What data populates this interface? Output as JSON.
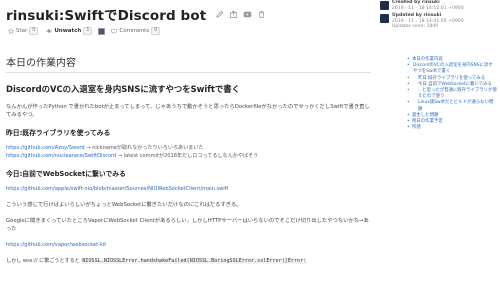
{
  "header": {
    "title": "rinsuki:SwiftでDiscord bot",
    "star_label": "Star",
    "star_count": "0",
    "watch_label": "Unwatch",
    "watch_count": "1",
    "comments_label": "Comments",
    "comments_count": "0",
    "icons": [
      "edit-icon",
      "share-icon",
      "youtube-icon",
      "trash-icon"
    ]
  },
  "info": {
    "created_label": "Created by rinsuki",
    "created_date": "2019 - 11 - 18 14:12:01 +0900",
    "updated_label": "Updated by rinsuki",
    "updated_date": "2019 - 11 - 18 14:41:05 +0900",
    "views": "Updates seen: 1840"
  },
  "main": {
    "section_title": "本日の作業内容",
    "h2": "DiscordのVCの入退室を身内SNSに流すやつをSwiftで書く",
    "intro": "なんかんが作ったPython で書かれたbotが止まってしまって、じゃあうちで動かそうと思ったらDockerfileがなかったのでせっかくだしSwiftで書き直してみるやつ。",
    "lib_heading": "昨日:既存ライブラリを使ってみる",
    "lib_link1": "https://github.com/Azoy/Sword",
    "lib_link1_note": " → nicknameが取れなかったりいろいろあいまいた",
    "lib_link2": "https://github.com/nuclearace/SwiftDiscord",
    "lib_link2_note": " → latest commitが2018年だしロコってるしなんかやばそう",
    "ws_heading": "今日:自前でWebSocketに繋いでみる",
    "ws_link1": "https://github.com/apple/swift-nio/blob/master/Sources/NIOWebSocketClient/main.swift",
    "ws_text1": "こういう感じで行けばよいらしいがちょっとWebSocketに繋ぎたいだけなのにこれはだるすぎる。",
    "ws_text2": "Googleに聞きまくっていたところVaporにWebSocket Clientがあるらしい。しかしHTTPサーバーはいらないのでそこだけ切り出したやつないかな→あった",
    "ws_link2": "https://github.com/vapor/websocket-kit",
    "code_prefix": "しかし wss:// に繋ごうとすると ",
    "code_text": "NIOSSL.NIOSSLError.handshakeFailed(NIOSSL.BoringSSLError.sslError([Error:"
  },
  "toc": {
    "items": [
      {
        "label": "本日の作業内容",
        "level": 1
      },
      {
        "label": "DiscordのVCの入退室を身内SNSに流すやつをSwiftで書く",
        "level": 2
      },
      {
        "label": "昨日:既存ライブラリを使ってみる",
        "level": 3
      },
      {
        "label": "今日:自前でWebSocketに繋いでみる",
        "level": 3
      },
      {
        "label": "...と思ったが普通に既存ライブラリが使えたので使う",
        "level": 3
      },
      {
        "label": "Linux版Swiftだとビルドが通らない問題",
        "level": 3
      },
      {
        "label": "発生した問題",
        "level": 1
      },
      {
        "label": "明日の作業予定",
        "level": 1
      },
      {
        "label": "所感",
        "level": 1
      }
    ]
  },
  "colors": {
    "link": "#2a6ac0",
    "text": "#333333",
    "rule": "#dddddd"
  }
}
